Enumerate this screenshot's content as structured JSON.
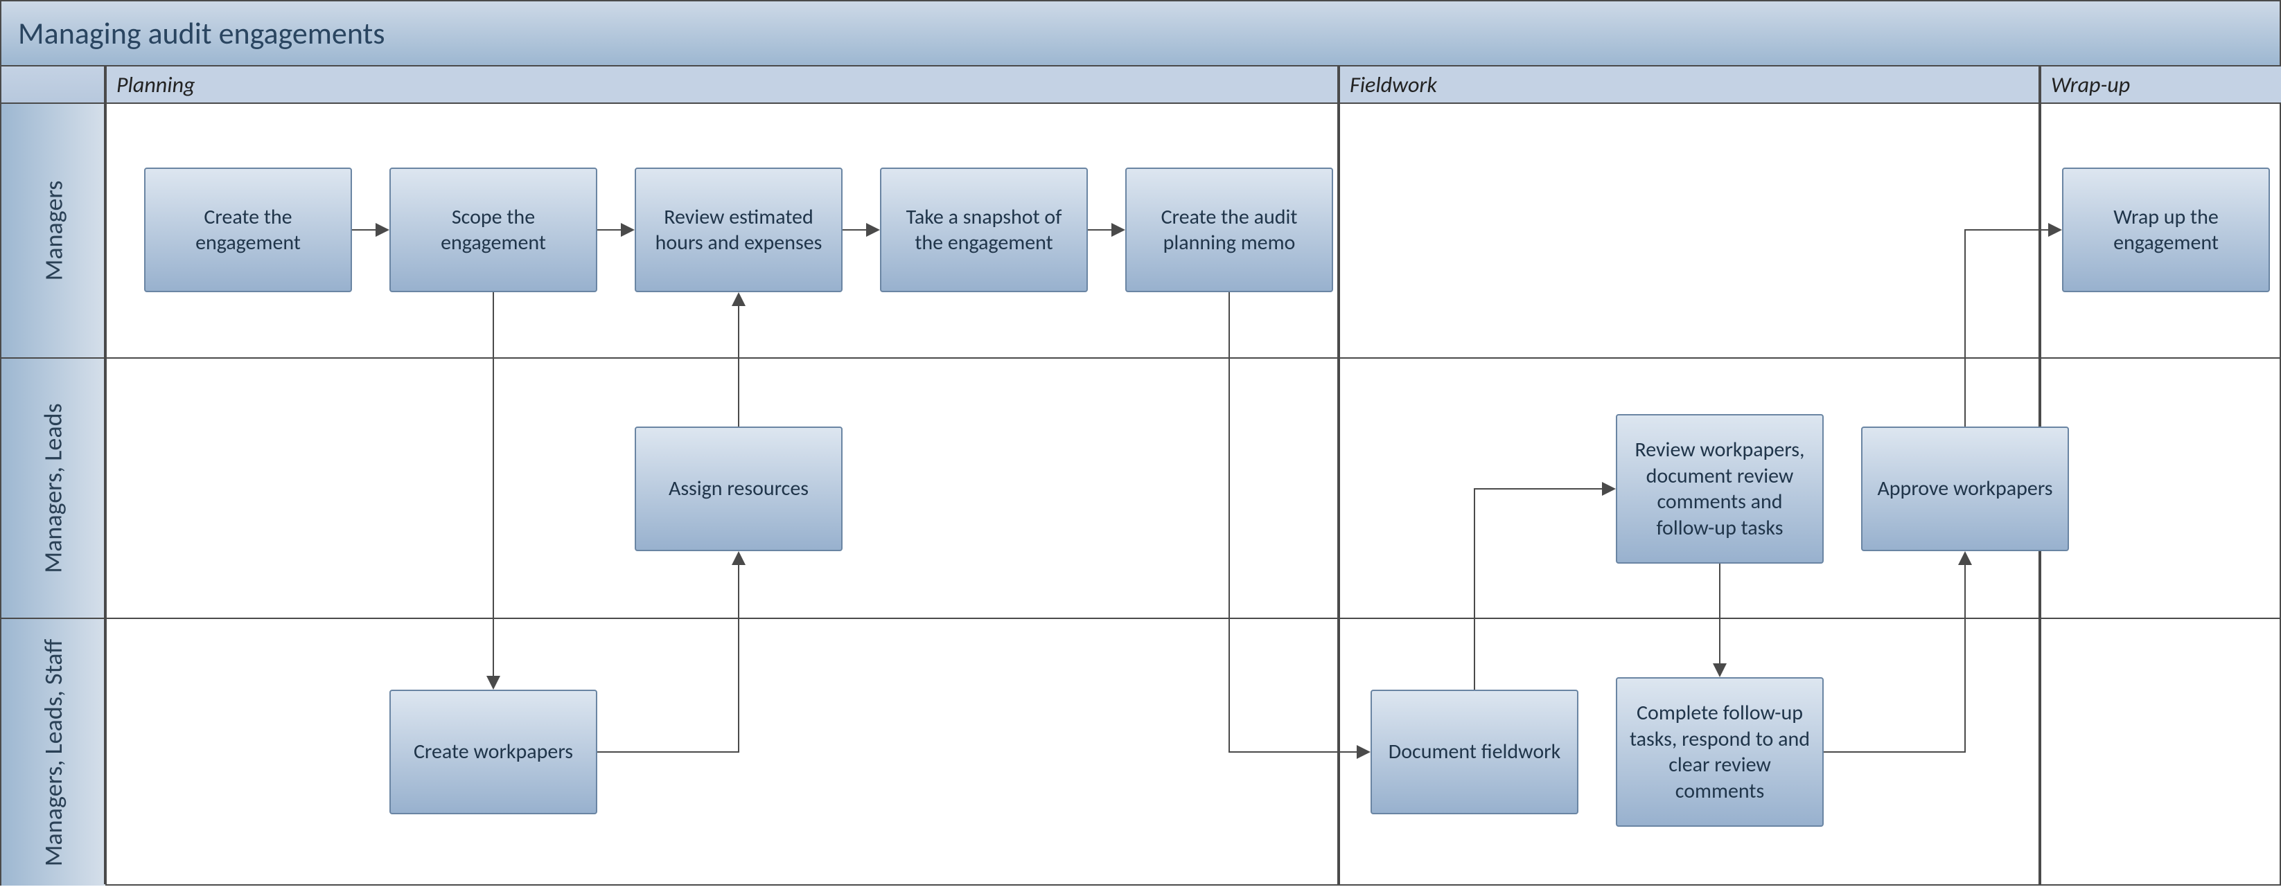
{
  "title": "Managing audit engagements",
  "phases": {
    "corner": "",
    "planning": "Planning",
    "fieldwork": "Fieldwork",
    "wrapup": "Wrap-up"
  },
  "lanes": {
    "managers": "Managers",
    "managers_leads": "Managers, Leads",
    "managers_leads_staff": "Managers, Leads, Staff"
  },
  "nodes": {
    "create_engagement": "Create the engagement",
    "scope_engagement": "Scope the engagement",
    "review_hours": "Review estimated hours and expenses",
    "take_snapshot": "Take a snapshot of the engagement",
    "create_memo": "Create the audit planning memo",
    "assign_resources": "Assign resources",
    "create_workpapers": "Create workpapers",
    "document_fieldwork": "Document fieldwork",
    "review_workpapers": "Review workpapers, document review comments and follow-up tasks",
    "complete_followup": "Complete follow-up tasks, respond to and clear review comments",
    "approve_workpapers": "Approve workpapers",
    "wrap_up": "Wrap up the engagement"
  }
}
